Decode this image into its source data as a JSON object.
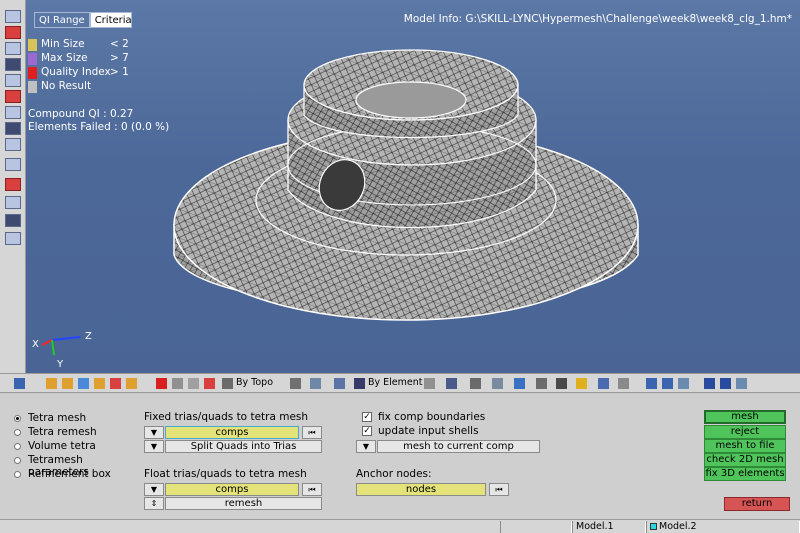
{
  "viewport": {
    "tabs": [
      "QI Range",
      "Criteria"
    ],
    "model_info": "Model Info: G:\\SKILL-LYNC\\Hypermesh\\Challenge\\week8\\week8_clg_1.hm*",
    "legend": [
      {
        "label": "Min Size",
        "value": "< 2",
        "color": "#d8c25a"
      },
      {
        "label": "Max Size",
        "value": "> 7",
        "color": "#9a6ad0"
      },
      {
        "label": "Quality Index",
        "value": "> 1",
        "color": "#e02020"
      },
      {
        "label": "No Result",
        "value": "",
        "color": "#c0c0c0"
      }
    ],
    "compound_qi": "Compound QI : 0.27",
    "elements_failed": "Elements Failed : 0 (0.0 %)",
    "triad": {
      "x": "X",
      "y": "Y",
      "z": "Z"
    }
  },
  "toolbar": {
    "by_topo": "By Topo",
    "by_element": "By Element C"
  },
  "panel": {
    "radios": [
      {
        "label": "Tetra mesh",
        "selected": true
      },
      {
        "label": "Tetra remesh",
        "selected": false
      },
      {
        "label": "Volume tetra",
        "selected": false
      },
      {
        "label": "Tetramesh parameters",
        "selected": false
      },
      {
        "label": "Refinement box",
        "selected": false
      }
    ],
    "fixed_label": "Fixed trias/quads to tetra mesh",
    "fixed_entity": "comps",
    "split_button": "Split Quads into Trias",
    "float_label": "Float trias/quads to tetra mesh",
    "float_entity": "comps",
    "remesh_button": "remesh",
    "checkboxes": [
      {
        "label": "fix comp boundaries",
        "checked": true
      },
      {
        "label": "update input shells",
        "checked": true
      }
    ],
    "mesh_to_current_comp": "mesh to current comp",
    "anchor_label": "Anchor nodes:",
    "anchor_entity": "nodes",
    "actions": [
      "mesh",
      "reject",
      "mesh to file",
      "check 2D mesh",
      "fix 3D elements"
    ],
    "return": "return"
  },
  "status_bar": {
    "model1": "Model.1",
    "model2": "Model.2"
  }
}
